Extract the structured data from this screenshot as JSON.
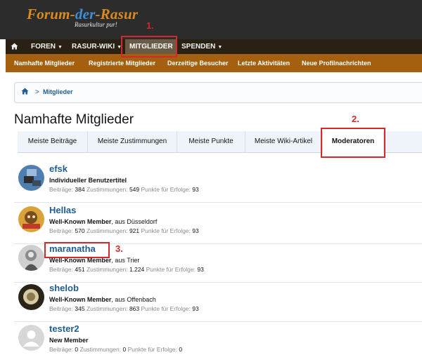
{
  "logo": {
    "part1": "Forum-",
    "part2": "der",
    "part3": "-Rasur",
    "tagline": "Rasurkultur pur!"
  },
  "nav": {
    "home_icon": "home-icon",
    "items": [
      {
        "label": "FOREN",
        "caret": "▼"
      },
      {
        "label": "RASUR-WIKI",
        "caret": "▼"
      },
      {
        "label": "MITGLIEDER",
        "caret": ""
      },
      {
        "label": "SPENDEN",
        "caret": "▼"
      }
    ]
  },
  "subnav": [
    "Namhafte Mitglieder",
    "Registrierte Mitglieder",
    "Derzeitige Besucher",
    "Letzte Aktivitäten",
    "Neue Profilnachrichten"
  ],
  "breadcrumb": {
    "home_icon": "home-icon",
    "separator": ">",
    "label": "Mitglieder"
  },
  "page_title": "Namhafte Mitglieder",
  "tabs": [
    "Meiste Beiträge",
    "Meiste Zustimmungen",
    "Meiste Punkte",
    "Meiste Wiki-Artikel",
    "Moderatoren"
  ],
  "active_tab": "Moderatoren",
  "members": [
    {
      "name": "efsk",
      "title": "Individueller Benutzertitel",
      "location": "",
      "posts_label": "Beiträge:",
      "posts": "384",
      "likes_label": "Zustimmungen:",
      "likes": "549",
      "points_label": "Punkte für Erfolge:",
      "points": "93"
    },
    {
      "name": "Hellas",
      "title": "Well-Known Member",
      "location": ", aus Düsseldorf",
      "posts_label": "Beiträge:",
      "posts": "570",
      "likes_label": "Zustimmungen:",
      "likes": "921",
      "points_label": "Punkte für Erfolge:",
      "points": "93"
    },
    {
      "name": "maranatha",
      "title": "Well-Known Member",
      "location": ", aus Trier",
      "posts_label": "Beiträge:",
      "posts": "451",
      "likes_label": "Zustimmungen:",
      "likes": "1.224",
      "points_label": "Punkte für Erfolge:",
      "points": "93"
    },
    {
      "name": "shelob",
      "title": "Well-Known Member",
      "location": ", aus Offenbach",
      "posts_label": "Beiträge:",
      "posts": "345",
      "likes_label": "Zustimmungen:",
      "likes": "863",
      "points_label": "Punkte für Erfolge:",
      "points": "93"
    },
    {
      "name": "tester2",
      "title": "New Member",
      "location": "",
      "posts_label": "Beiträge:",
      "posts": "0",
      "likes_label": "Zustimmungen:",
      "likes": "0",
      "points_label": "Punkte für Erfolge:",
      "points": "0"
    }
  ],
  "annotations": [
    "1.",
    "2.",
    "3."
  ],
  "colors": {
    "annotation": "#d12a2a",
    "subnav": "#a4600f",
    "link": "#1f5c8f"
  }
}
